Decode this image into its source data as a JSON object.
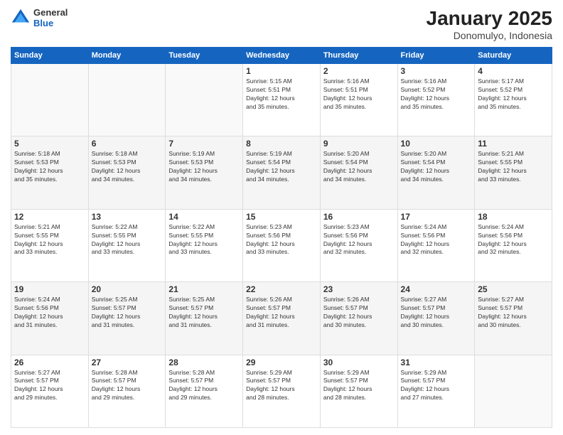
{
  "header": {
    "logo_general": "General",
    "logo_blue": "Blue",
    "title": "January 2025",
    "subtitle": "Donomulyo, Indonesia"
  },
  "days_of_week": [
    "Sunday",
    "Monday",
    "Tuesday",
    "Wednesday",
    "Thursday",
    "Friday",
    "Saturday"
  ],
  "weeks": [
    {
      "days": [
        {
          "num": "",
          "info": ""
        },
        {
          "num": "",
          "info": ""
        },
        {
          "num": "",
          "info": ""
        },
        {
          "num": "1",
          "info": "Sunrise: 5:15 AM\nSunset: 5:51 PM\nDaylight: 12 hours\nand 35 minutes."
        },
        {
          "num": "2",
          "info": "Sunrise: 5:16 AM\nSunset: 5:51 PM\nDaylight: 12 hours\nand 35 minutes."
        },
        {
          "num": "3",
          "info": "Sunrise: 5:16 AM\nSunset: 5:52 PM\nDaylight: 12 hours\nand 35 minutes."
        },
        {
          "num": "4",
          "info": "Sunrise: 5:17 AM\nSunset: 5:52 PM\nDaylight: 12 hours\nand 35 minutes."
        }
      ]
    },
    {
      "days": [
        {
          "num": "5",
          "info": "Sunrise: 5:18 AM\nSunset: 5:53 PM\nDaylight: 12 hours\nand 35 minutes."
        },
        {
          "num": "6",
          "info": "Sunrise: 5:18 AM\nSunset: 5:53 PM\nDaylight: 12 hours\nand 34 minutes."
        },
        {
          "num": "7",
          "info": "Sunrise: 5:19 AM\nSunset: 5:53 PM\nDaylight: 12 hours\nand 34 minutes."
        },
        {
          "num": "8",
          "info": "Sunrise: 5:19 AM\nSunset: 5:54 PM\nDaylight: 12 hours\nand 34 minutes."
        },
        {
          "num": "9",
          "info": "Sunrise: 5:20 AM\nSunset: 5:54 PM\nDaylight: 12 hours\nand 34 minutes."
        },
        {
          "num": "10",
          "info": "Sunrise: 5:20 AM\nSunset: 5:54 PM\nDaylight: 12 hours\nand 34 minutes."
        },
        {
          "num": "11",
          "info": "Sunrise: 5:21 AM\nSunset: 5:55 PM\nDaylight: 12 hours\nand 33 minutes."
        }
      ]
    },
    {
      "days": [
        {
          "num": "12",
          "info": "Sunrise: 5:21 AM\nSunset: 5:55 PM\nDaylight: 12 hours\nand 33 minutes."
        },
        {
          "num": "13",
          "info": "Sunrise: 5:22 AM\nSunset: 5:55 PM\nDaylight: 12 hours\nand 33 minutes."
        },
        {
          "num": "14",
          "info": "Sunrise: 5:22 AM\nSunset: 5:55 PM\nDaylight: 12 hours\nand 33 minutes."
        },
        {
          "num": "15",
          "info": "Sunrise: 5:23 AM\nSunset: 5:56 PM\nDaylight: 12 hours\nand 33 minutes."
        },
        {
          "num": "16",
          "info": "Sunrise: 5:23 AM\nSunset: 5:56 PM\nDaylight: 12 hours\nand 32 minutes."
        },
        {
          "num": "17",
          "info": "Sunrise: 5:24 AM\nSunset: 5:56 PM\nDaylight: 12 hours\nand 32 minutes."
        },
        {
          "num": "18",
          "info": "Sunrise: 5:24 AM\nSunset: 5:56 PM\nDaylight: 12 hours\nand 32 minutes."
        }
      ]
    },
    {
      "days": [
        {
          "num": "19",
          "info": "Sunrise: 5:24 AM\nSunset: 5:56 PM\nDaylight: 12 hours\nand 31 minutes."
        },
        {
          "num": "20",
          "info": "Sunrise: 5:25 AM\nSunset: 5:57 PM\nDaylight: 12 hours\nand 31 minutes."
        },
        {
          "num": "21",
          "info": "Sunrise: 5:25 AM\nSunset: 5:57 PM\nDaylight: 12 hours\nand 31 minutes."
        },
        {
          "num": "22",
          "info": "Sunrise: 5:26 AM\nSunset: 5:57 PM\nDaylight: 12 hours\nand 31 minutes."
        },
        {
          "num": "23",
          "info": "Sunrise: 5:26 AM\nSunset: 5:57 PM\nDaylight: 12 hours\nand 30 minutes."
        },
        {
          "num": "24",
          "info": "Sunrise: 5:27 AM\nSunset: 5:57 PM\nDaylight: 12 hours\nand 30 minutes."
        },
        {
          "num": "25",
          "info": "Sunrise: 5:27 AM\nSunset: 5:57 PM\nDaylight: 12 hours\nand 30 minutes."
        }
      ]
    },
    {
      "days": [
        {
          "num": "26",
          "info": "Sunrise: 5:27 AM\nSunset: 5:57 PM\nDaylight: 12 hours\nand 29 minutes."
        },
        {
          "num": "27",
          "info": "Sunrise: 5:28 AM\nSunset: 5:57 PM\nDaylight: 12 hours\nand 29 minutes."
        },
        {
          "num": "28",
          "info": "Sunrise: 5:28 AM\nSunset: 5:57 PM\nDaylight: 12 hours\nand 29 minutes."
        },
        {
          "num": "29",
          "info": "Sunrise: 5:29 AM\nSunset: 5:57 PM\nDaylight: 12 hours\nand 28 minutes."
        },
        {
          "num": "30",
          "info": "Sunrise: 5:29 AM\nSunset: 5:57 PM\nDaylight: 12 hours\nand 28 minutes."
        },
        {
          "num": "31",
          "info": "Sunrise: 5:29 AM\nSunset: 5:57 PM\nDaylight: 12 hours\nand 27 minutes."
        },
        {
          "num": "",
          "info": ""
        }
      ]
    }
  ]
}
